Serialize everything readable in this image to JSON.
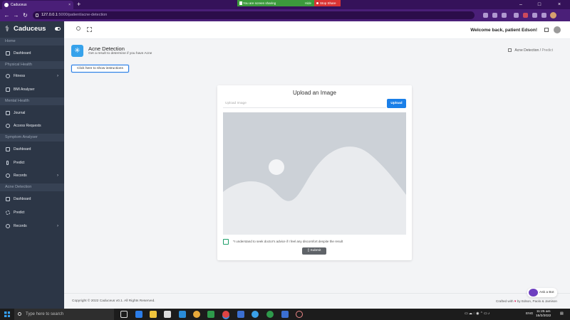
{
  "browser": {
    "tab_title": "Caduceus",
    "tab_close": "×",
    "new_tab": "+",
    "url_host": "127.0.0.1",
    "url_path": ":5000/patient/acne-detection",
    "sharing_text": "You are screen sharing",
    "sharing_hide": "Hide",
    "stop_share": "Stop Share",
    "win_min": "–",
    "win_max": "□",
    "win_close": "×",
    "back": "←",
    "forward": "→",
    "reload": "↻"
  },
  "sidebar": {
    "brand": "Caduceus",
    "logo": "⚕",
    "sections": [
      {
        "label": "Home"
      },
      {
        "label": "Physical Health"
      },
      {
        "label": "Mental Health"
      },
      {
        "label": "Symptom Analyser"
      },
      {
        "label": "Acne Detection"
      }
    ],
    "items": [
      {
        "label": "Dashboard",
        "icon": "chart-icon"
      },
      {
        "label": "Fitness",
        "icon": "stopwatch-icon",
        "chevron": "›"
      },
      {
        "label": "BMI Analyser",
        "icon": "scale-icon"
      },
      {
        "label": "Journal",
        "icon": "book-icon"
      },
      {
        "label": "Access Requests",
        "icon": "clock-icon"
      },
      {
        "label": "Dashboard",
        "icon": "chart-icon"
      },
      {
        "label": "Predict",
        "icon": "thermometer-icon"
      },
      {
        "label": "Records",
        "icon": "list-icon",
        "chevron": "›"
      },
      {
        "label": "Dashboard",
        "icon": "chart-icon"
      },
      {
        "label": "Predict",
        "icon": "sparkle-icon"
      },
      {
        "label": "Records",
        "icon": "list-icon",
        "chevron": "›"
      }
    ]
  },
  "topnav": {
    "welcome": "Welcome back, patient Edson!"
  },
  "page": {
    "title": "Acne Detection",
    "subtitle": "Get a result to determine if you have Acne",
    "breadcrumb": [
      "Acne Detection",
      "Predict"
    ],
    "breadcrumb_sep": "/",
    "instructions_button": "Click here to show instructions"
  },
  "card": {
    "title": "Upload an Image",
    "file_placeholder": "Upload Image",
    "upload_button": "Upload",
    "consent": "*I understand to seek doctor's advice if I feel any discomfort despite the result",
    "submit_button": "Submit",
    "submit_icon": "▯"
  },
  "footer": {
    "copyright": "Copyright © 2022 Caduceus v0.1. All Rights Reserved.",
    "crafted_prefix": "Crafted with",
    "heart": "♥",
    "crafted_suffix": "by Edson, Paolo & Jamison"
  },
  "bot": {
    "label": "Ask a Bot"
  },
  "taskbar": {
    "search_placeholder": "Type here to search",
    "lang": "ENG",
    "time": "11:25 am",
    "date": "15/2/2022"
  },
  "colors": {
    "sidebar_bg": "#2c3646",
    "accent": "#1a7fe8",
    "browser_purple": "#4a1f78"
  }
}
